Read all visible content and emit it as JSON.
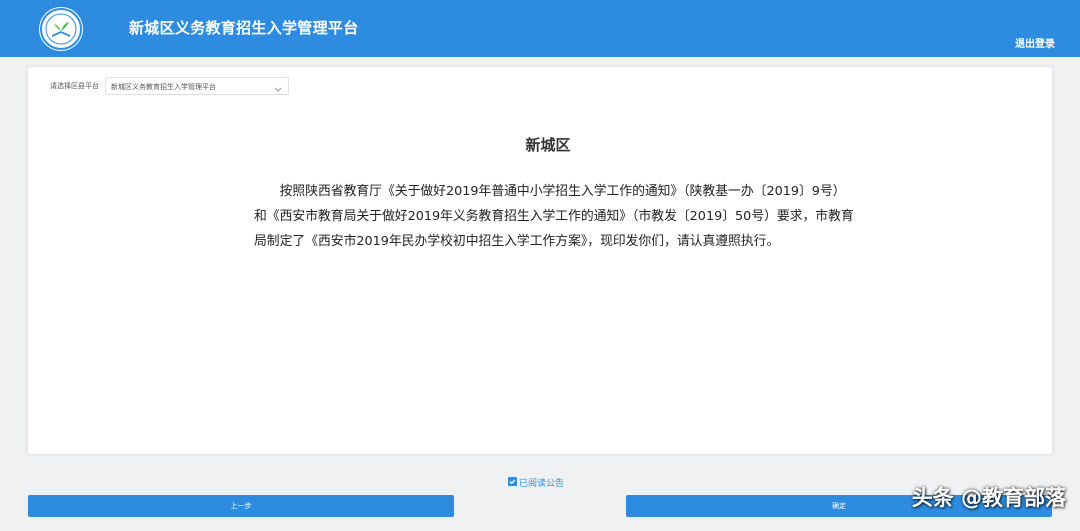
{
  "header": {
    "title": "新城区义务教育招生入学管理平台",
    "logout_label": "退出登录"
  },
  "selector": {
    "label": "请选择区县平台",
    "value": "新城区义务教育招生入学管理平台"
  },
  "notice": {
    "title": "新城区",
    "body": "按照陕西省教育厅《关于做好2019年普通中小学招生入学工作的通知》（陕教基一办〔2019〕9号）和《西安市教育局关于做好2019年义务教育招生入学工作的通知》（市教发〔2019〕50号）要求，市教育局制定了《西安市2019年民办学校初中招生入学工作方案》，现印发你们，请认真遵照执行。"
  },
  "agreement": {
    "label": "已阅读公告",
    "checked": true
  },
  "buttons": {
    "prev_label": "上一步",
    "confirm_label": "确定"
  },
  "watermark": "头条 @教育部落",
  "colors": {
    "primary": "#2d8ce0",
    "background": "#f0f1f3"
  },
  "icons": {
    "logo": "school-logo-icon",
    "dropdown": "chevron-down-icon",
    "checkbox": "checkmark-icon"
  }
}
